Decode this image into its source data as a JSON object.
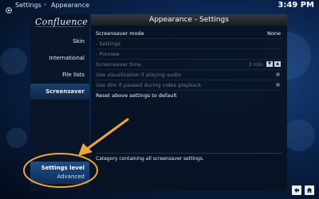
{
  "topbar": {
    "crumbs": [
      "Settings",
      "Appearance"
    ],
    "clock": "3:49 PM"
  },
  "sidebar": {
    "logo": "Confluence",
    "items": [
      {
        "label": "Skin"
      },
      {
        "label": "International"
      },
      {
        "label": "File lists"
      },
      {
        "label": "Screensaver",
        "active": true
      }
    ],
    "settings_level": {
      "title": "Settings level",
      "value": "Advanced"
    }
  },
  "panel": {
    "title": "Appearance - Settings",
    "rows": [
      {
        "label": "Screensaver mode",
        "value": "None",
        "enabled": true
      },
      {
        "label": "- Settings",
        "enabled": false
      },
      {
        "label": "- Preview",
        "enabled": false
      },
      {
        "label": "Screensaver time",
        "value": "3 min",
        "enabled": false
      },
      {
        "label": "Use visualization if playing audio",
        "enabled": false
      },
      {
        "label": "Use dim if paused during video playback",
        "enabled": false
      },
      {
        "label": "Reset above settings to default",
        "enabled": true
      }
    ],
    "description": "Category containing all screensaver settings."
  },
  "annotation": {
    "color": "#f0a43a"
  },
  "icons": {
    "settings": "gear-icon",
    "back": "back-arrow-icon",
    "home": "home-icon"
  }
}
